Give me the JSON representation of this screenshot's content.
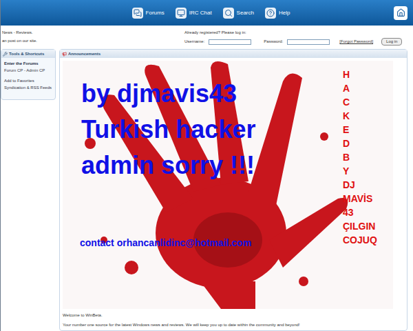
{
  "nav": [
    {
      "label": "Forums",
      "icon": "forums"
    },
    {
      "label": "IRC Chat",
      "icon": "irc"
    },
    {
      "label": "Search",
      "icon": "search"
    },
    {
      "label": "Help",
      "icon": "help"
    }
  ],
  "top": {
    "left_lines": [
      "News - Reviews.",
      "an post on our site."
    ],
    "login_prompt": "Already registered? Please log in:",
    "username_label": "Username:",
    "password_label": "Password:",
    "forgot": "[Forgot Password]",
    "login_button": "Log in"
  },
  "sidebar": {
    "title": "Tools & Shortcuts",
    "items": [
      {
        "label": "Enter the Forums",
        "kind": "heading"
      },
      {
        "label": "Forum CP - Admin CP",
        "kind": "link"
      },
      {
        "label": "Add to Favorites",
        "kind": "gap-link"
      },
      {
        "label": "Syndication & RSS Feeds",
        "kind": "link"
      }
    ]
  },
  "announcements": {
    "title": "Announcements",
    "overlay": {
      "lines": [
        "by djmavis43",
        "Turkish hacker",
        "admin sorry !!!"
      ],
      "contact": "contact orhancanlidinc@hotmail.com",
      "vertical": [
        "H",
        "A",
        "C",
        "K",
        "E",
        "D",
        "B",
        "Y",
        "DJ",
        "MAVİS",
        "43",
        "ÇILGIN",
        "COJUQ"
      ]
    },
    "welcome": "Welcome to WinBeta.",
    "description": "Your number one source for the latest Windows news and reviews. We will keep you up to date within the community and beyond!"
  }
}
